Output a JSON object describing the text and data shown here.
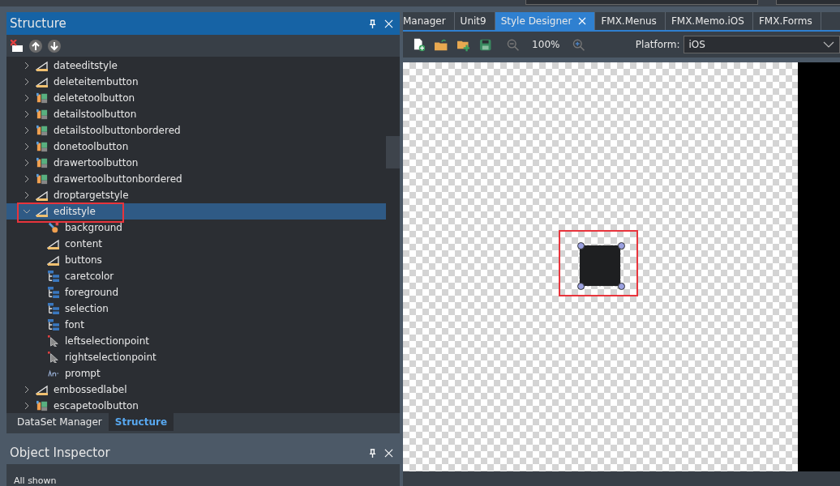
{
  "structure_panel": {
    "title": "Structure",
    "tree": [
      {
        "label": "dateeditstyle",
        "kind": "style",
        "expanded": false,
        "selected": false
      },
      {
        "label": "deleteitembutton",
        "kind": "style",
        "expanded": false,
        "selected": false
      },
      {
        "label": "deletetoolbutton",
        "kind": "toolbutton",
        "expanded": false,
        "selected": false
      },
      {
        "label": "detailstoolbutton",
        "kind": "toolbutton",
        "expanded": false,
        "selected": false
      },
      {
        "label": "detailstoolbuttonbordered",
        "kind": "toolbutton",
        "expanded": false,
        "selected": false
      },
      {
        "label": "donetoolbutton",
        "kind": "toolbutton",
        "expanded": false,
        "selected": false
      },
      {
        "label": "drawertoolbutton",
        "kind": "toolbutton",
        "expanded": false,
        "selected": false
      },
      {
        "label": "drawertoolbuttonbordered",
        "kind": "toolbutton",
        "expanded": false,
        "selected": false
      },
      {
        "label": "droptargetstyle",
        "kind": "style",
        "expanded": false,
        "selected": false
      },
      {
        "label": "editstyle",
        "kind": "style",
        "expanded": true,
        "selected": true,
        "children": [
          {
            "label": "background",
            "kind": "brush",
            "selected": false
          },
          {
            "label": "content",
            "kind": "style",
            "selected": false
          },
          {
            "label": "buttons",
            "kind": "style",
            "selected": false
          },
          {
            "label": "caretcolor",
            "kind": "list",
            "selected": false
          },
          {
            "label": "foreground",
            "kind": "list",
            "selected": false
          },
          {
            "label": "selection",
            "kind": "list",
            "selected": false
          },
          {
            "label": "font",
            "kind": "list",
            "selected": false
          },
          {
            "label": "leftselectionpoint",
            "kind": "pointer",
            "selected": false
          },
          {
            "label": "rightselectionpoint",
            "kind": "pointer",
            "selected": false
          },
          {
            "label": "prompt",
            "kind": "text",
            "selected": false
          }
        ]
      },
      {
        "label": "embossedlabel",
        "kind": "style",
        "expanded": false,
        "selected": false
      },
      {
        "label": "escapetoolbutton",
        "kind": "toolbutton",
        "expanded": false,
        "selected": false
      }
    ],
    "bottom_tabs": [
      {
        "label": "DataSet Manager",
        "selected": false
      },
      {
        "label": "Structure",
        "selected": true
      }
    ]
  },
  "object_inspector": {
    "title": "Object Inspector",
    "filter_text": "All shown"
  },
  "editor_tabs": [
    {
      "label": "Manager",
      "selected": false
    },
    {
      "label": "Unit9",
      "selected": false
    },
    {
      "label": "Style Designer",
      "selected": true
    },
    {
      "label": "FMX.Menus",
      "selected": false
    },
    {
      "label": "FMX.Memo.iOS",
      "selected": false
    },
    {
      "label": "FMX.Forms",
      "selected": false
    }
  ],
  "designer_toolbar": {
    "zoom": "100%",
    "platform_label": "Platform:",
    "platform": "iOS"
  }
}
